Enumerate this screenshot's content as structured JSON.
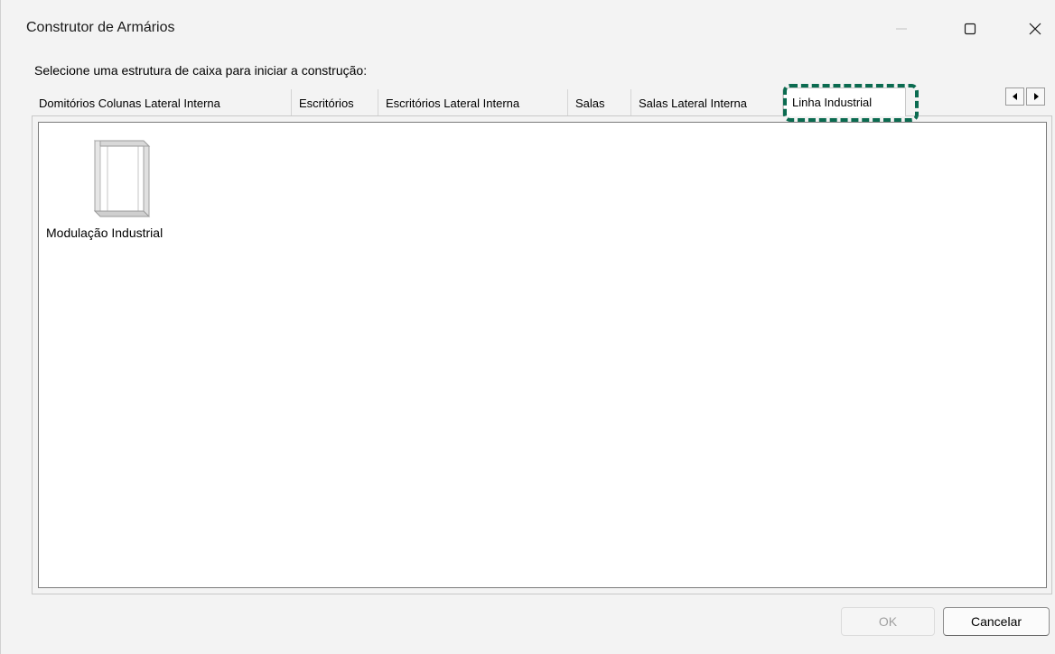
{
  "window": {
    "title": "Construtor de Armários",
    "controls": {
      "minimize": "minimize-icon",
      "maximize": "maximize-icon",
      "close": "close-icon"
    }
  },
  "prompt": "Selecione uma estrutura de caixa para iniciar a construção:",
  "tabs": [
    {
      "label": "Domitórios Colunas Lateral Interna",
      "active": false
    },
    {
      "label": "Escritórios",
      "active": false
    },
    {
      "label": "Escritórios Lateral Interna",
      "active": false
    },
    {
      "label": "Salas",
      "active": false
    },
    {
      "label": "Salas Lateral Interna",
      "active": false
    },
    {
      "label": "Linha Industrial",
      "active": true
    }
  ],
  "tab_scroll": {
    "left": "scroll-left-icon",
    "right": "scroll-right-icon"
  },
  "items": [
    {
      "label": "Modulação Industrial",
      "icon": "cabinet-frame-icon"
    }
  ],
  "buttons": {
    "ok": "OK",
    "ok_enabled": false,
    "cancel": "Cancelar"
  },
  "colors": {
    "highlight": "#0b6b50",
    "window_bg": "#f3f3f3",
    "list_bg": "#ffffff"
  }
}
